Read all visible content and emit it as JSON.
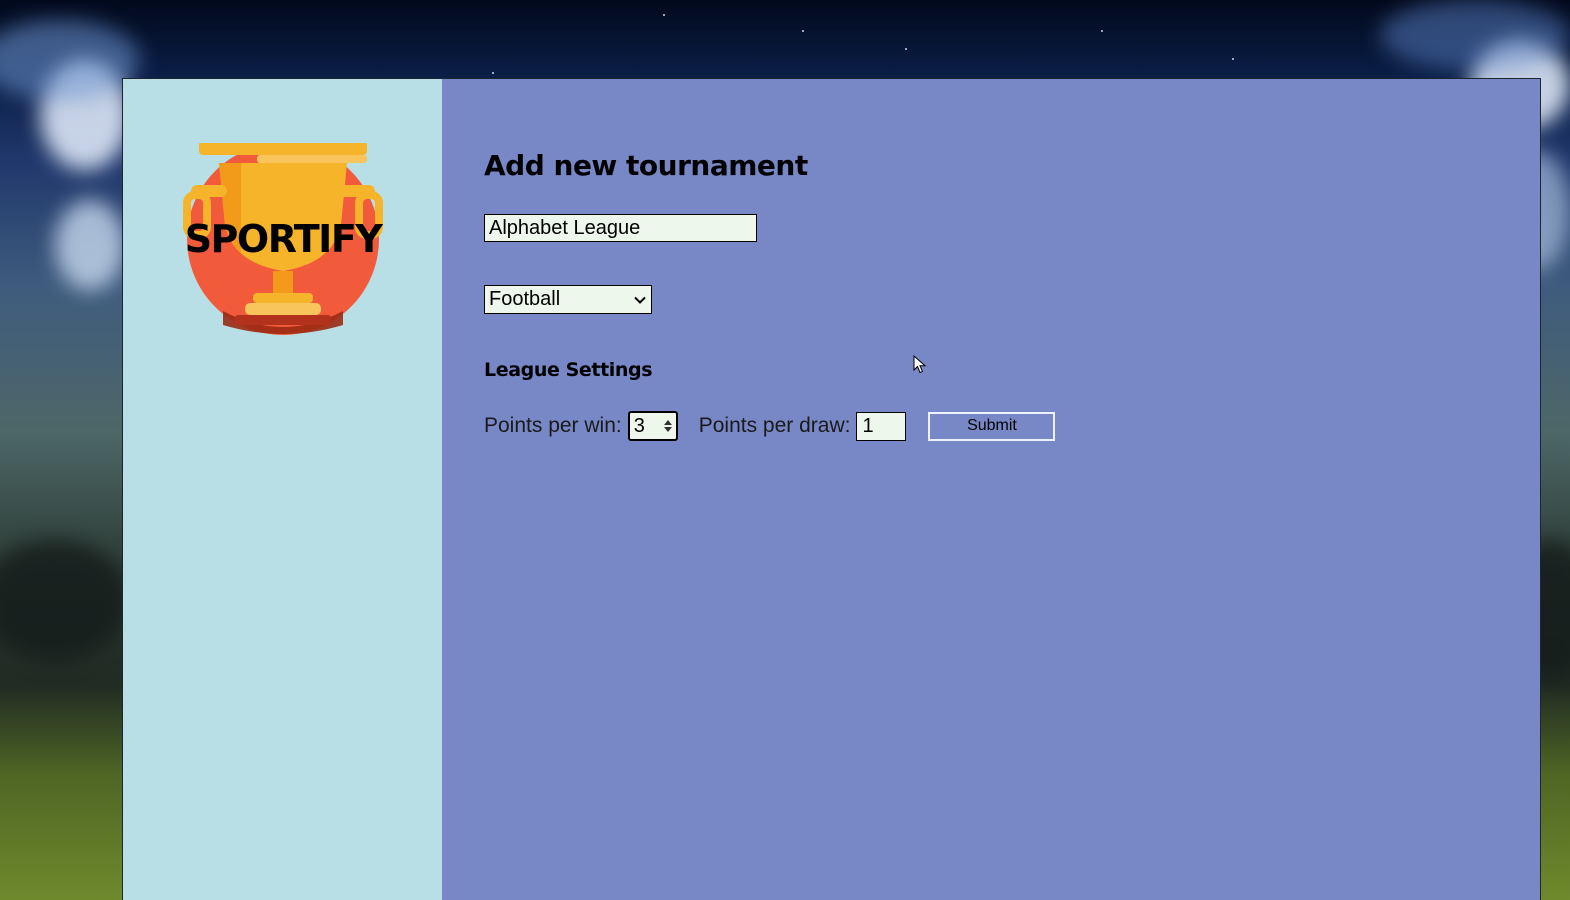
{
  "app": {
    "logo_text": "SPORTIFY"
  },
  "form": {
    "title": "Add new tournament",
    "tournament_name_value": "Alphabet League",
    "sport_select": {
      "selected": "Football"
    },
    "league_settings": {
      "title": "League Settings",
      "points_per_win_label": "Points per win:",
      "points_per_win_value": "3",
      "points_per_draw_label": "Points per draw:",
      "points_per_draw_value": "1"
    },
    "submit_label": "Submit"
  },
  "colors": {
    "sidebar_bg": "#b8dfe6",
    "main_bg": "#7888c6",
    "input_bg": "#edf7ec",
    "logo_circle": "#f25a3c",
    "logo_trophy": "#f6b42b"
  },
  "icons": [
    "sportify-logo",
    "chevron-down-icon",
    "spinner-icon",
    "mouse-cursor-icon"
  ]
}
